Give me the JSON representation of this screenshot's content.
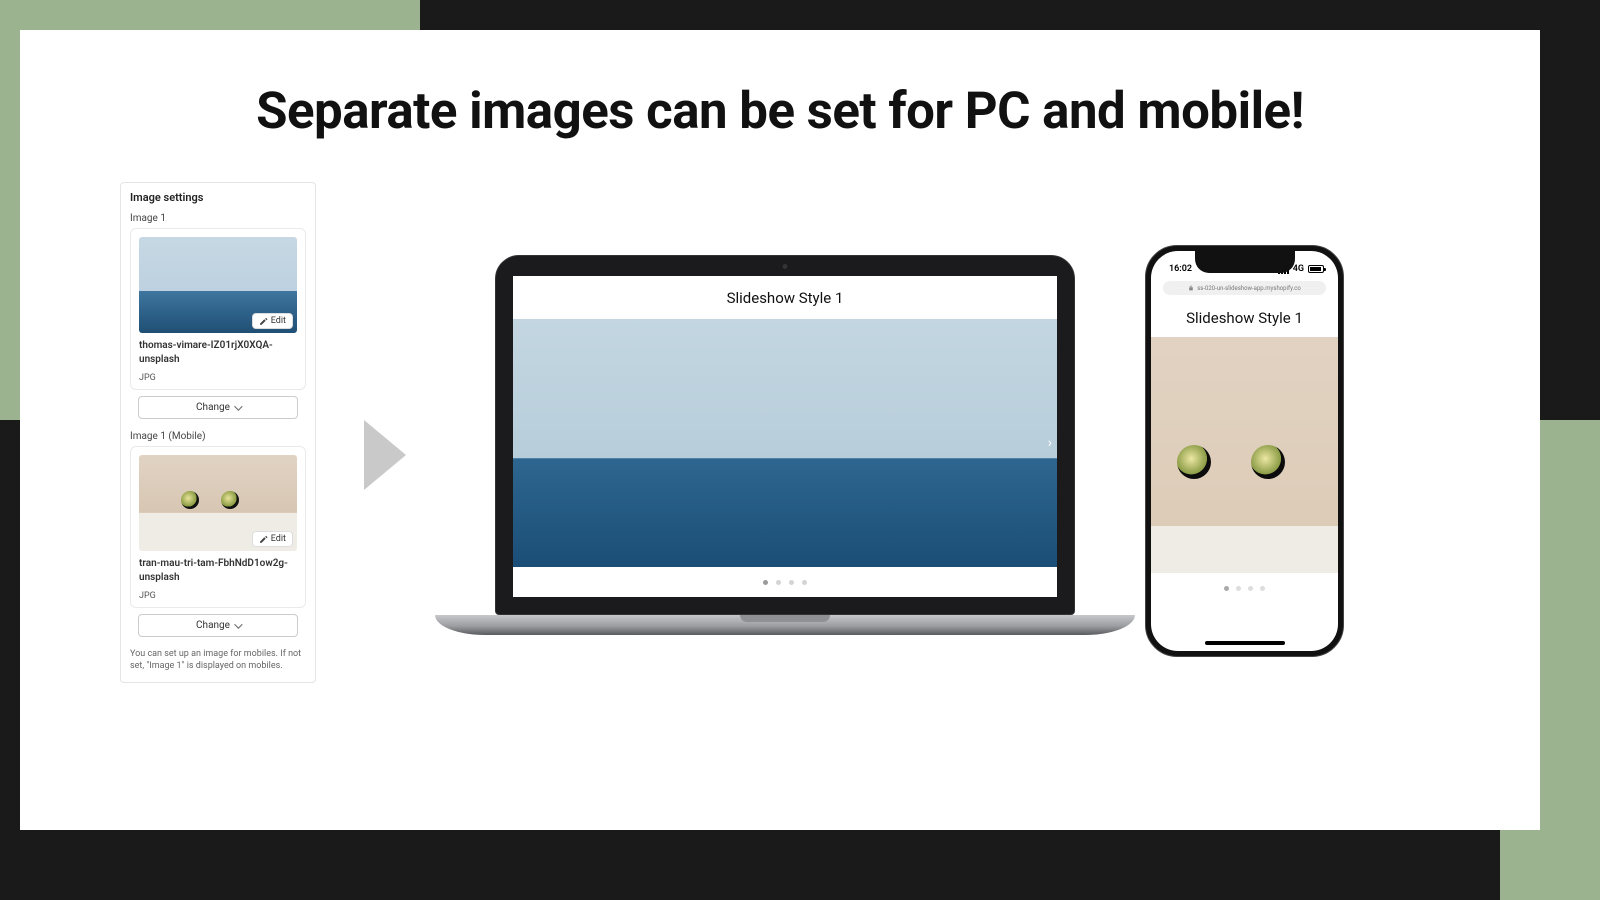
{
  "headline": "Separate images can be set for PC and mobile!",
  "settings": {
    "title": "Image settings",
    "field1_label": "Image 1",
    "field2_label": "Image 1 (Mobile)",
    "edit_label": "Edit",
    "change_label": "Change",
    "help_text": "You can set up an image for mobiles. If not set, \"Image 1\" is displayed on mobiles.",
    "image1": {
      "filename": "thomas-vimare-IZ01rjX0XQA-unsplash",
      "filetype": "JPG"
    },
    "image2": {
      "filename": "tran-mau-tri-tam-FbhNdD1ow2g-unsplash",
      "filetype": "JPG"
    }
  },
  "laptop": {
    "title": "Slideshow Style 1"
  },
  "phone": {
    "status_time": "16:02",
    "status_net": "4G",
    "address": "ss-020-un-slideshow-app.myshopify.co",
    "title": "Slideshow Style 1"
  }
}
